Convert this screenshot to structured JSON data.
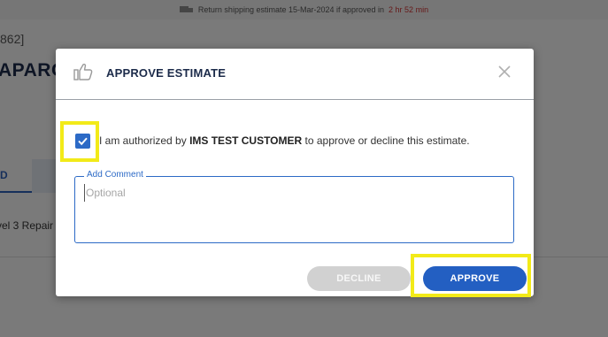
{
  "background": {
    "shipping_notice": {
      "prefix": "Return shipping estimate 15-Mar-2024 if approved in",
      "time_left": "2 hr 52 min",
      "icon": "truck-icon"
    },
    "record_id_fragment": "862]",
    "title_fragment": "APAROS",
    "tab_fragment": "D",
    "line_fragment": "vel 3 Repair ("
  },
  "modal": {
    "title": "APPROVE ESTIMATE",
    "header_icon": "thumbs-up-icon",
    "close_icon": "close-icon",
    "authorization": {
      "checked": true,
      "prefix": "I am authorized by",
      "customer": "IMS TEST CUSTOMER",
      "suffix": "to approve or decline this estimate."
    },
    "comment": {
      "label": "Add Comment",
      "placeholder": "Optional",
      "value": ""
    },
    "buttons": {
      "decline": "DECLINE",
      "approve": "APPROVE"
    }
  },
  "colors": {
    "primary": "#235fc2",
    "highlight": "#f2ea18",
    "disabled": "#d1d1d1",
    "alert": "#cc3333"
  }
}
